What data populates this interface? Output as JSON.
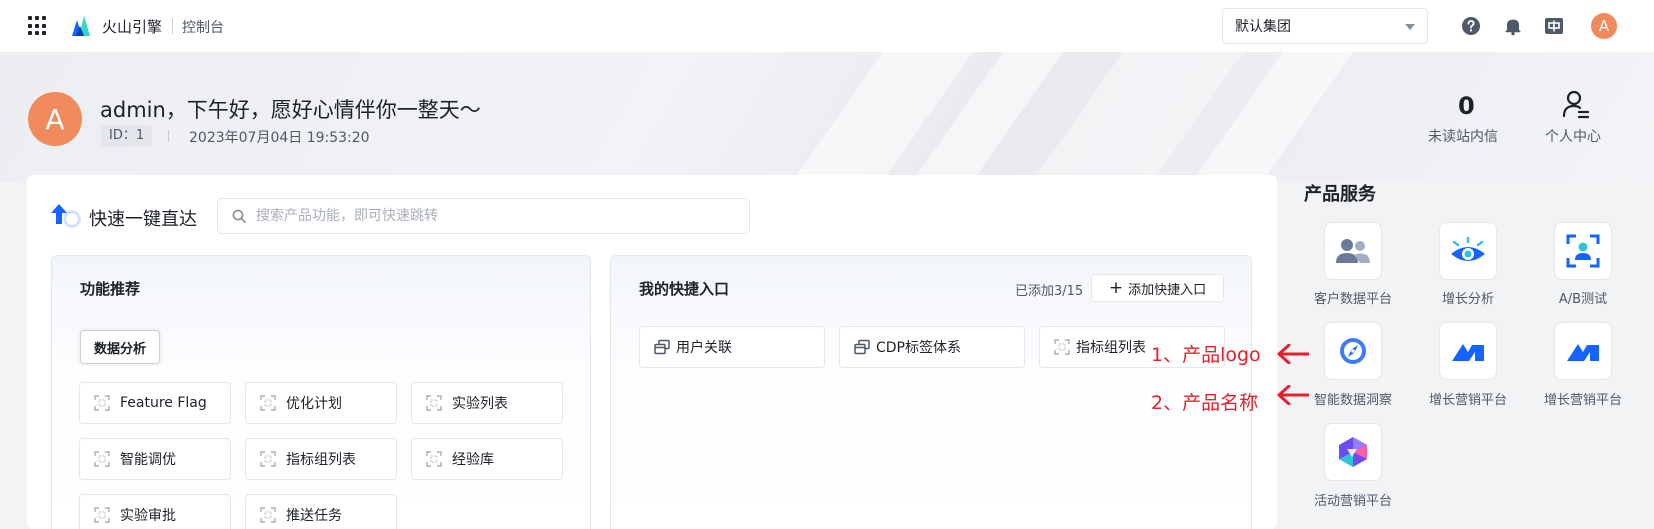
{
  "header": {
    "brand": "火山引擎",
    "console": "控制台",
    "group_select": "默认集团",
    "avatar_letter": "A"
  },
  "hero": {
    "greeting": "admin，下午好，愿好心情伴你一整天～",
    "id_label": "ID：1",
    "datetime": "2023年07月04日 19:53:20",
    "unread_count": "0",
    "unread_label": "未读站内信",
    "personal_label": "个人中心",
    "avatar_letter": "A"
  },
  "quick": {
    "title": "快速一键直达",
    "search_placeholder": "搜索产品功能，即可快速跳转"
  },
  "features": {
    "title": "功能推荐",
    "active_tag": "数据分析",
    "items": [
      "Feature Flag",
      "优化计划",
      "实验列表",
      "智能调优",
      "指标组列表",
      "经验库",
      "实验审批",
      "推送任务"
    ]
  },
  "shortcuts": {
    "title": "我的快捷入口",
    "count": "已添加3/15",
    "add_label": "添加快捷入口",
    "items": [
      "用户关联",
      "CDP标签体系",
      "指标组列表"
    ]
  },
  "products": {
    "title": "产品服务",
    "items": [
      {
        "label": "客户数据平台",
        "icon": "users-icon"
      },
      {
        "label": "增长分析",
        "icon": "eye-icon"
      },
      {
        "label": "A/B测试",
        "icon": "ab-test-icon"
      },
      {
        "label": "智能数据洞察",
        "icon": "compass-icon"
      },
      {
        "label": "增长营销平台",
        "icon": "growth-marketing-icon"
      },
      {
        "label": "增长营销平台",
        "icon": "growth-marketing-icon"
      },
      {
        "label": "活动营销平台",
        "icon": "campaign-icon"
      }
    ]
  },
  "annotations": {
    "logo_note": "1、产品logo",
    "name_note": "2、产品名称",
    "color": "#e5202a"
  },
  "colors": {
    "avatar": "#f08a5d",
    "brand_blue": "#1664ff"
  }
}
